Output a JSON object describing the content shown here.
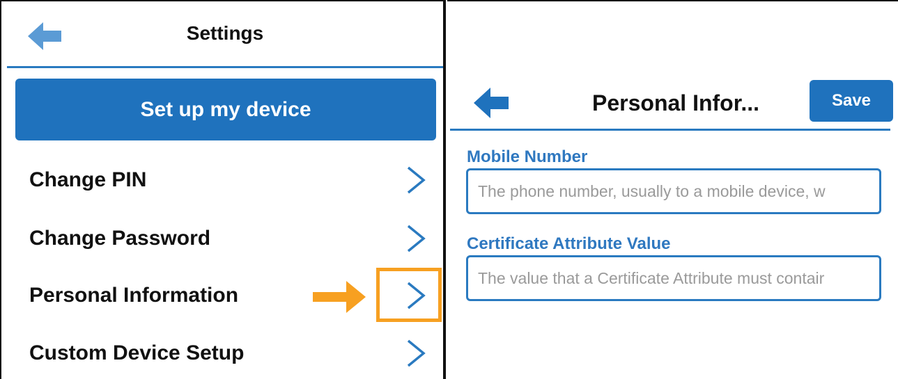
{
  "left": {
    "header": {
      "title": "Settings"
    },
    "setup_button": "Set up my device",
    "menu": [
      {
        "label": "Change PIN"
      },
      {
        "label": "Change Password"
      },
      {
        "label": "Personal Information"
      },
      {
        "label": "Custom Device Setup"
      }
    ],
    "colors": {
      "accent": "#1f72bd",
      "highlight": "#f7a021",
      "back_arrow": "#5b9bd5"
    },
    "icons": {
      "back": "back-arrow-icon",
      "chevron": "chevron-right-icon",
      "callout": "orange-arrow-icon"
    }
  },
  "right": {
    "header": {
      "title": "Personal Infor...",
      "save_label": "Save"
    },
    "fields": [
      {
        "label": "Mobile Number",
        "placeholder": "The phone number, usually to a mobile device, w"
      },
      {
        "label": "Certificate Attribute Value",
        "placeholder": "The value that a Certificate Attribute must contair"
      }
    ],
    "colors": {
      "accent": "#1f72bd",
      "label": "#2f78c0"
    }
  }
}
